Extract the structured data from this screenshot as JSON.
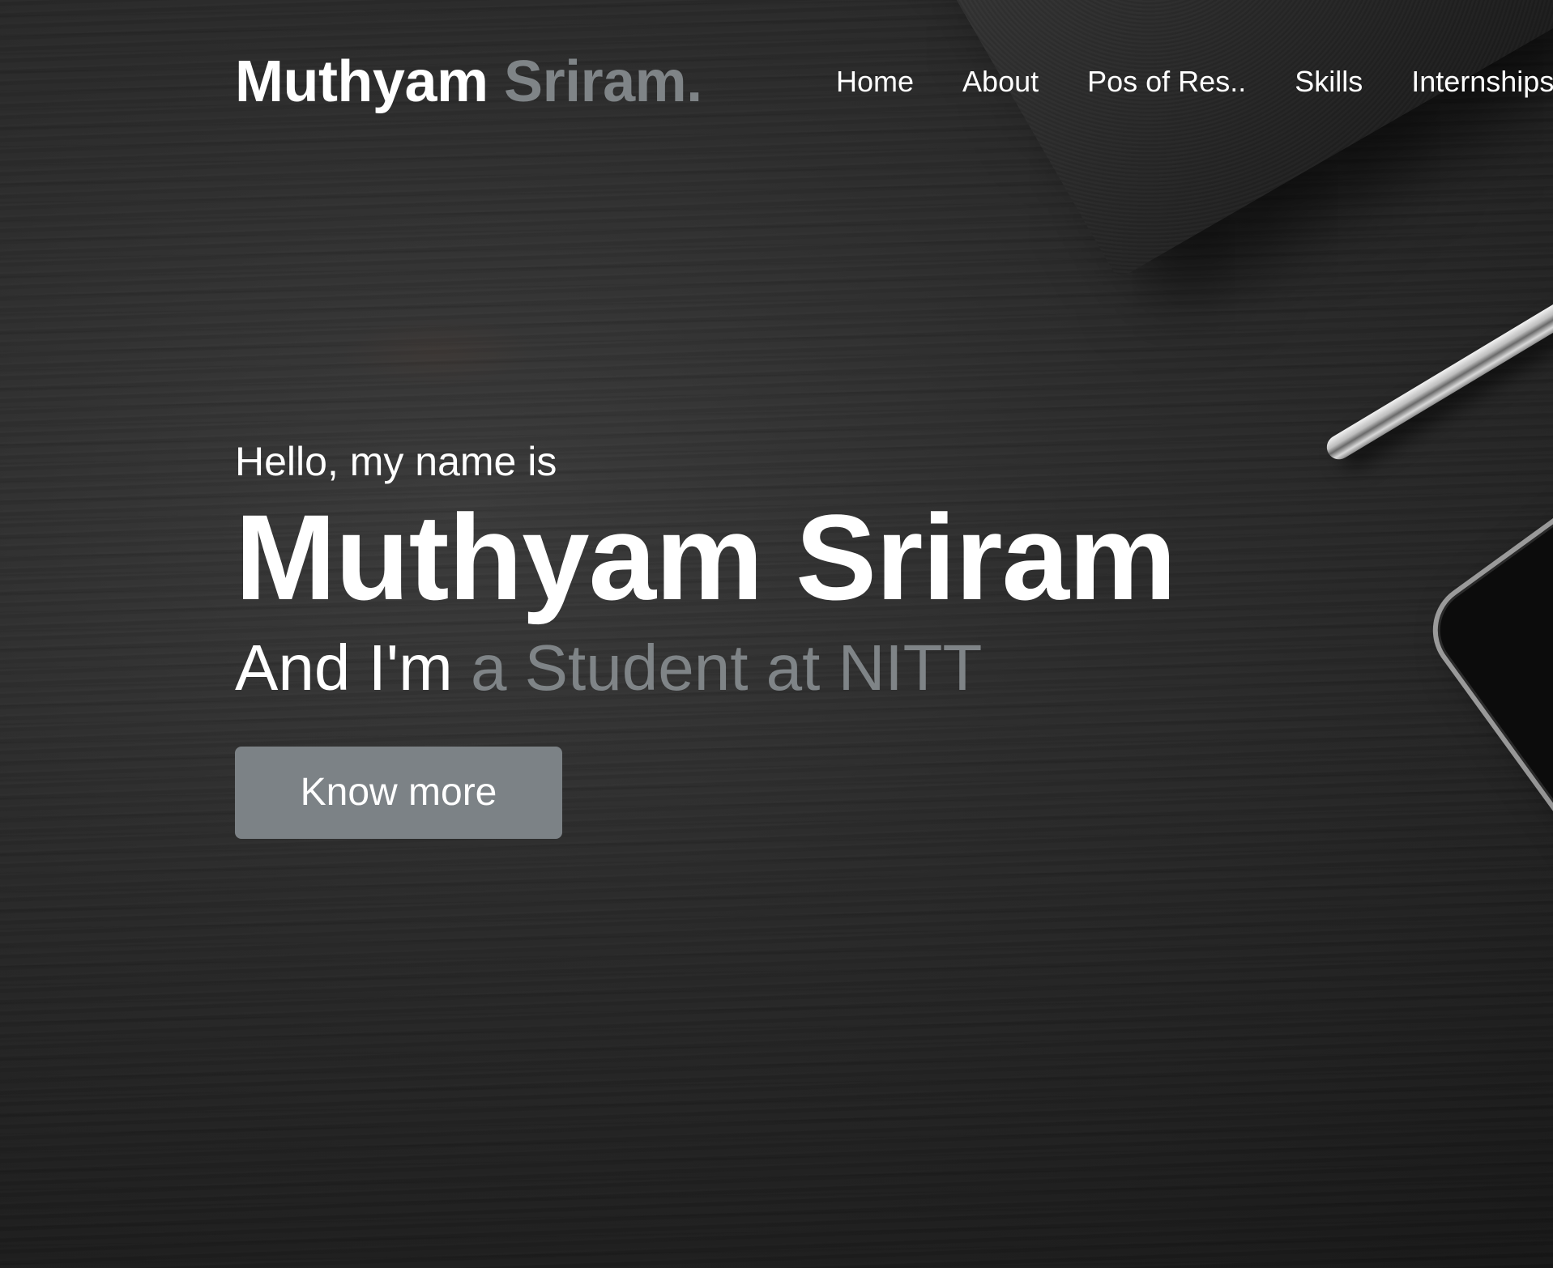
{
  "header": {
    "logo_first": "Muthyam",
    "logo_second": "Sriram.",
    "nav": [
      {
        "label": "Home"
      },
      {
        "label": "About"
      },
      {
        "label": "Pos of Res.."
      },
      {
        "label": "Skills"
      },
      {
        "label": "Internships"
      }
    ]
  },
  "hero": {
    "greeting": "Hello, my name is",
    "name": "Muthyam Sriram",
    "role_prefix": "And I'm",
    "role_typed": "a Student at NITT",
    "button_label": "Know more"
  },
  "colors": {
    "accent_gray": "#7f8487",
    "button_bg": "#7c8286",
    "text": "#ffffff",
    "background": "#2a2a2a"
  }
}
